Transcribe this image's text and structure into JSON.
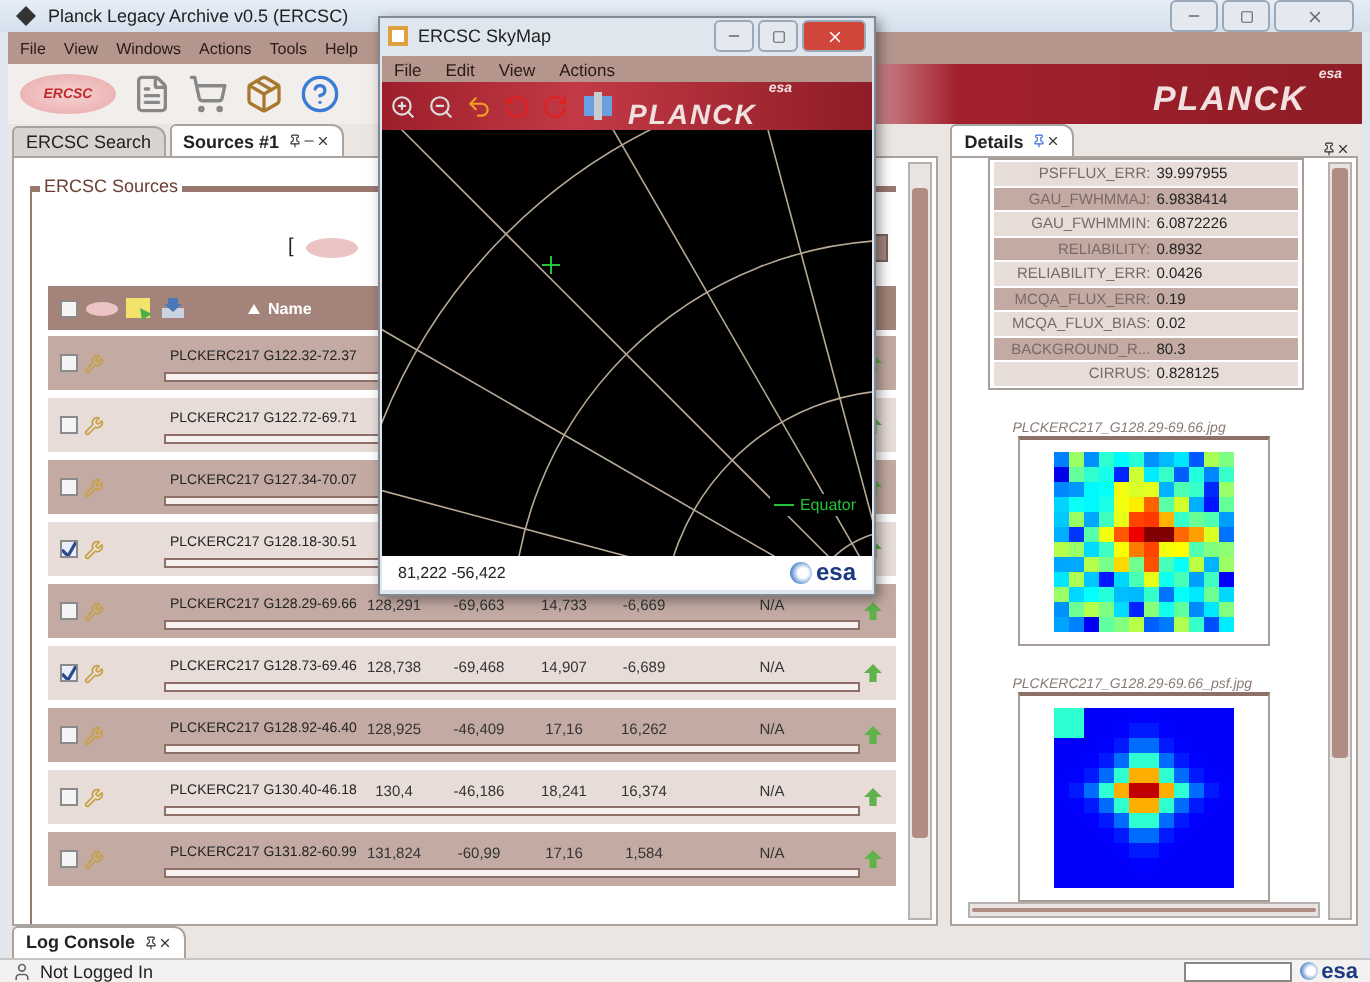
{
  "window": {
    "title": "Planck Legacy Archive v0.5 (ERCSC)"
  },
  "menu": [
    "File",
    "View",
    "Windows",
    "Actions",
    "Tools",
    "Help"
  ],
  "toolbar": {
    "logo": "ERCSC",
    "banner": "PLANCK",
    "agency": "esa"
  },
  "tabs": [
    {
      "label": "ERCSC Search",
      "selected": false
    },
    {
      "label": "Sources #1",
      "selected": true
    }
  ],
  "sources": {
    "title": "ERCSC Sources",
    "bracket": "[",
    "select_all_checked": false,
    "header_name": "Name",
    "rows": [
      {
        "name": "PLCKERC217 G122.32-72.37",
        "checked": false
      },
      {
        "name": "PLCKERC217 G122.72-69.71",
        "checked": false
      },
      {
        "name": "PLCKERC217 G127.34-70.07",
        "checked": false
      },
      {
        "name": "PLCKERC217 G128.18-30.51",
        "checked": true
      },
      {
        "name": "PLCKERC217 G128.29-69.66",
        "checked": false,
        "values": [
          "128,291",
          "-69,663",
          "14,733",
          "-6,669",
          "N/A"
        ]
      },
      {
        "name": "PLCKERC217 G128.73-69.46",
        "checked": true,
        "values": [
          "128,738",
          "-69,468",
          "14,907",
          "-6,689",
          "N/A"
        ]
      },
      {
        "name": "PLCKERC217 G128.92-46.40",
        "checked": false,
        "values": [
          "128,925",
          "-46,409",
          "17,16",
          "16,262",
          "N/A"
        ]
      },
      {
        "name": "PLCKERC217 G130.40-46.18",
        "checked": false,
        "values": [
          "130,4",
          "-46,186",
          "18,241",
          "16,374",
          "N/A"
        ]
      },
      {
        "name": "PLCKERC217 G131.82-60.99",
        "checked": false,
        "values": [
          "131,824",
          "-60,99",
          "17,16",
          "1,584",
          "N/A"
        ]
      }
    ]
  },
  "details": {
    "tab": "Details",
    "properties": [
      {
        "label": "PSFFLUX_ERR:",
        "value": "39.997955"
      },
      {
        "label": "GAU_FWHMMAJ:",
        "value": "6.9838414"
      },
      {
        "label": "GAU_FWHMMIN:",
        "value": "6.0872226"
      },
      {
        "label": "RELIABILITY:",
        "value": "0.8932"
      },
      {
        "label": "RELIABILITY_ERR:",
        "value": "0.0426"
      },
      {
        "label": "MCQA_FLUX_ERR:",
        "value": "0.19"
      },
      {
        "label": "MCQA_FLUX_BIAS:",
        "value": "0.02"
      },
      {
        "label": "BACKGROUND_R...",
        "value": "80.3"
      },
      {
        "label": "CIRRUS:",
        "value": "0.828125"
      }
    ],
    "images": [
      {
        "caption": "PLCKERC217_G128.29-69.66.jpg",
        "kind": "map"
      },
      {
        "caption": "PLCKERC217_G128.29-69.66_psf.jpg",
        "kind": "psf"
      }
    ]
  },
  "log": {
    "tab": "Log Console"
  },
  "status": {
    "text": "Not Logged In",
    "agency": "esa"
  },
  "skymap": {
    "title": "ERCSC SkyMap",
    "menu": [
      "File",
      "Edit",
      "View",
      "Actions"
    ],
    "banner": "PLANCK",
    "agency": "esa",
    "equator_label": "Equator",
    "coordinates": "81,222 -56,422",
    "footer_agency": "esa"
  }
}
